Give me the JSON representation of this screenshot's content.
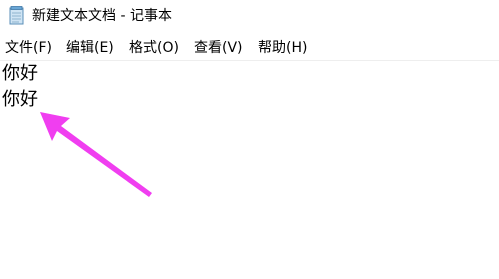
{
  "window": {
    "title": "新建文本文档 - 记事本"
  },
  "menu": {
    "items": [
      {
        "label": "文件(F)"
      },
      {
        "label": "编辑(E)"
      },
      {
        "label": "格式(O)"
      },
      {
        "label": "查看(V)"
      },
      {
        "label": "帮助(H)"
      }
    ]
  },
  "editor": {
    "lines": [
      "你好",
      "你好"
    ]
  },
  "annotation": {
    "arrow_color": "#f03ef0",
    "icon": "arrow-icon"
  },
  "icons": {
    "app": "notepad-icon"
  }
}
